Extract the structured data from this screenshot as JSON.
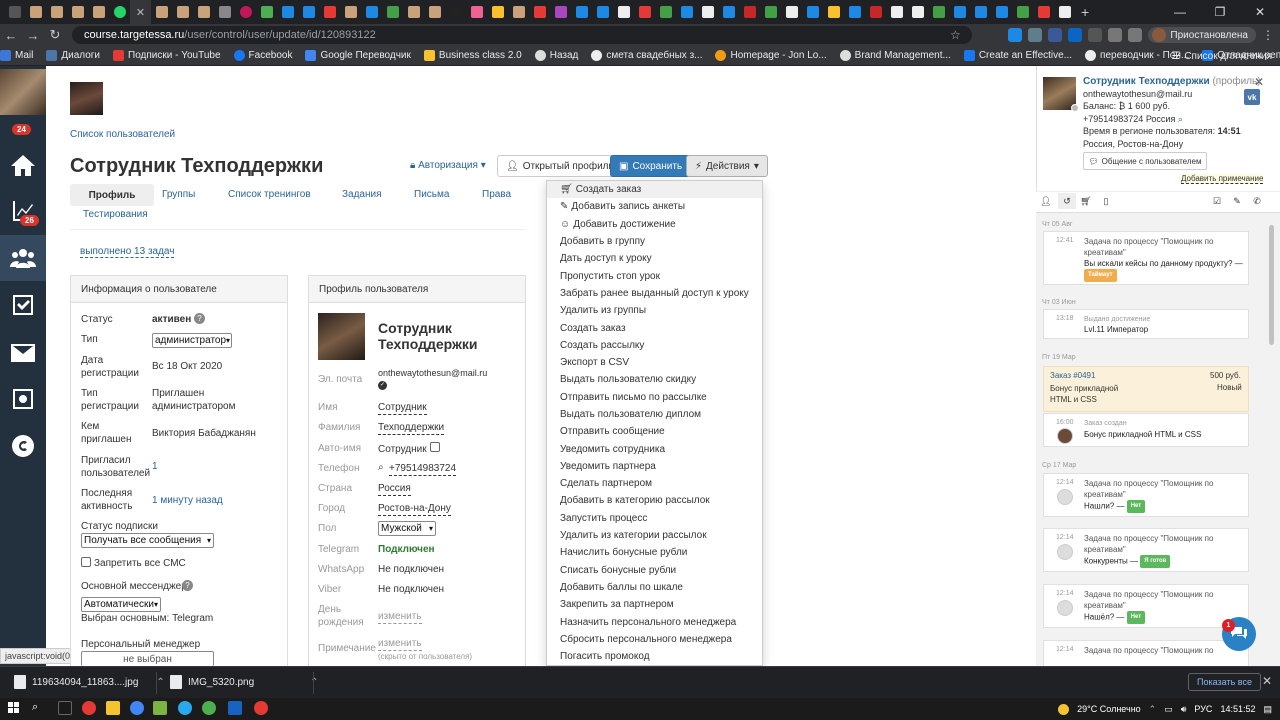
{
  "browser": {
    "url_host": "course.targetessa.ru",
    "url_path": "/user/control/user/update/id/120893122",
    "profile_label": "Приостановлена",
    "bookmarks": [
      "Mail",
      "Диалоги",
      "Подписки - YouTube",
      "Facebook",
      "Google Переводчик",
      "Business class 2.0",
      "Назад",
      "смета свадебных з...",
      "Homepage - Jon Lo...",
      "Brand Management...",
      "Create an Effective...",
      "переводчик - Пои...",
      "Отладчик репосто..."
    ],
    "reading_list": "Список для чтения"
  },
  "leftbar": {
    "badge_top": "24",
    "badge_chart": "26",
    "status_text": "javascript:void(0)"
  },
  "page": {
    "users_link": "Список пользователей",
    "title": "Сотрудник Техподдержки",
    "auth_button": "Авторизация",
    "open_profile_button": "Открытый профиль",
    "save_button": "Сохранить",
    "actions_button": "Действия",
    "tabs": [
      "Профиль",
      "Группы",
      "Список тренингов",
      "Задания",
      "Письма",
      "Права",
      "Тестирования"
    ],
    "tasks_done": "выполнено 13 задач"
  },
  "user_info": {
    "header": "Информация о пользователе",
    "status_label": "Статус",
    "status_value": "активен",
    "type_label": "Тип",
    "type_value": "администратор",
    "reg_date_label": "Дата регистрации",
    "reg_date_value": "Вс 18 Окт 2020",
    "reg_type_label": "Тип регистрации",
    "reg_type_value": "Приглашен администратором",
    "invited_by_label": "Кем приглашен",
    "invited_by_value": "Виктория Бабаджанян",
    "invited_users_label": "Пригласил пользователей",
    "invited_users_value": "1",
    "last_activity_label": "Последняя активность",
    "last_activity_value": "1 минуту назад",
    "sub_status_label": "Статус подписки",
    "sub_status_value": "Получать все сообщения",
    "ban_sms_label": "Запретить все СМС",
    "messenger_label": "Основной мессенджер",
    "messenger_value": "Автоматически",
    "messenger_chosen": "Выбран основным: Telegram",
    "manager_label": "Персональный менеджер",
    "manager_value": "не выбран"
  },
  "profile": {
    "header": "Профиль пользователя",
    "name": "Сотрудник Техподдержки",
    "email_label": "Эл. почта",
    "email_value": "onthewaytothesun@mail.ru",
    "first_name_label": "Имя",
    "first_name_value": "Сотрудник",
    "last_name_label": "Фамилия",
    "last_name_value": "Техподдержки",
    "auto_name_label": "Авто-имя",
    "auto_name_value": "Сотрудник",
    "phone_label": "Телефон",
    "phone_value": "+79514983724",
    "country_label": "Страна",
    "country_value": "Россия",
    "city_label": "Город",
    "city_value": "Ростов-на-Дону",
    "gender_label": "Пол",
    "gender_value": "Мужской",
    "telegram_label": "Telegram",
    "telegram_value": "Подключен",
    "whatsapp_label": "WhatsApp",
    "whatsapp_value": "Не подключен",
    "viber_label": "Viber",
    "viber_value": "Не подключен",
    "birthday_label": "День рождения",
    "birthday_value": "изменить",
    "note_label": "Примечание",
    "note_value": "изменить",
    "note_hint": "(скрыто от пользователя)"
  },
  "actions_menu": [
    "Создать заказ",
    "Добавить запись анкеты",
    "Добавить достижение",
    "Добавить в группу",
    "Дать доступ к уроку",
    "Пропустить стоп урок",
    "Забрать ранее выданный доступ к уроку",
    "Удалить из группы",
    "Создать заказ",
    "Создать рассылку",
    "Экспорт в CSV",
    "Выдать пользователю скидку",
    "Отправить письмо по рассылке",
    "Выдать пользователю диплом",
    "Отправить сообщение",
    "Уведомить сотрудника",
    "Уведомить партнера",
    "Сделать партнером",
    "Добавить в категорию рассылок",
    "Запустить процесс",
    "Удалить из категории рассылок",
    "Начислить бонусные рубли",
    "Списать бонусные рубли",
    "Добавить баллы по шкале",
    "Закрепить за партнером",
    "Назначить персонального менеджера",
    "Сбросить персонального менеджера",
    "Погасить промокод"
  ],
  "right_panel": {
    "name": "Сотрудник Техподдержки",
    "profile_link": "(профиль)",
    "email": "onthewaytothesun@mail.ru",
    "balance": "Баланс: ₿ 1 600 руб.",
    "phone": "+79514983724 Россия",
    "time_label": "Время в регионе пользователя:",
    "time_value": "14:51",
    "location": "Россия, Ростов-на-Дону",
    "chat_button": "Общение с пользователем",
    "add_note": "Добавить примечание",
    "feed": [
      {
        "date": "Чт 05 Авг",
        "time": "12:41",
        "title": "Задача по процессу \"Помощник по креативам\"",
        "body": "Вы искали кейсы по данному продукту? —",
        "tag": "Таймаут",
        "tag_color": "#f0ad4e"
      },
      {
        "date": "Чт 03 Июн",
        "time": "13:18",
        "title": "Выдано достижение",
        "body": "Lvl.11 Император"
      },
      {
        "date": "Пт 19 Мар",
        "order_title": "Заказ #0491",
        "order_sum": "500 руб.",
        "order_product": "Бонус прикладной HTML и CSS",
        "order_status": "Новый"
      },
      {
        "time": "16:00",
        "title": "Заказ создан",
        "body": "Бонус прикладной HTML и CSS"
      },
      {
        "date": "Ср 17 Мар",
        "time": "12:14",
        "title": "Задача по процессу \"Помощник по креативам\"",
        "body": "Нашли? —",
        "tag": "Нет",
        "tag_color": "#5cb85c"
      },
      {
        "time": "12:14",
        "title": "Задача по процессу \"Помощник по креативам\"",
        "body": "Конкуренты —",
        "tag": "Я готов",
        "tag_color": "#5cb85c"
      },
      {
        "time": "12:14",
        "title": "Задача по процессу \"Помощник по креативам\"",
        "body": "Нашёл? —",
        "tag": "Нет",
        "tag_color": "#5cb85c"
      },
      {
        "time": "12:14",
        "title": "Задача по процессу \"Помощник по"
      }
    ],
    "chat_badge": "1"
  },
  "downloads": {
    "file1": "119634094_11863....jpg",
    "file2": "IMG_5320.png",
    "show_all": "Показать все"
  },
  "taskbar": {
    "weather": "29°C Солнечно",
    "lang": "РУС",
    "clock": "14:51:52"
  }
}
